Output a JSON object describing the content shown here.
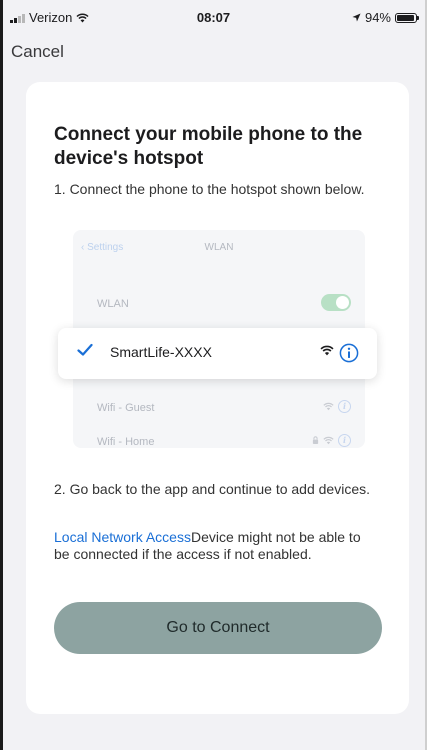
{
  "status_bar": {
    "carrier": "Verizon",
    "time": "08:07",
    "battery": "94%",
    "battery_level": 0.94
  },
  "nav": {
    "cancel_label": "Cancel"
  },
  "card": {
    "title": "Connect your mobile phone to the device's hotspot",
    "step1": "1. Connect the phone to the hotspot shown below.",
    "illustration": {
      "back_label": "Settings",
      "header_title": "WLAN",
      "wlan_label": "WLAN",
      "network_selected": "SmartLife-XXXX",
      "network_guest": "Wifi - Guest",
      "network_home": "Wifi - Home"
    },
    "step2": "2. Go back to the app and continue to add devices.",
    "note_link": "Local Network Access",
    "note_text": "Device might not be able to be connected if the access if not enabled.",
    "connect_label": "Go to Connect"
  },
  "colors": {
    "accent_blue": "#1a6fd6",
    "button_bg": "#8da3a1",
    "toggle_on": "#b8e0c5"
  }
}
